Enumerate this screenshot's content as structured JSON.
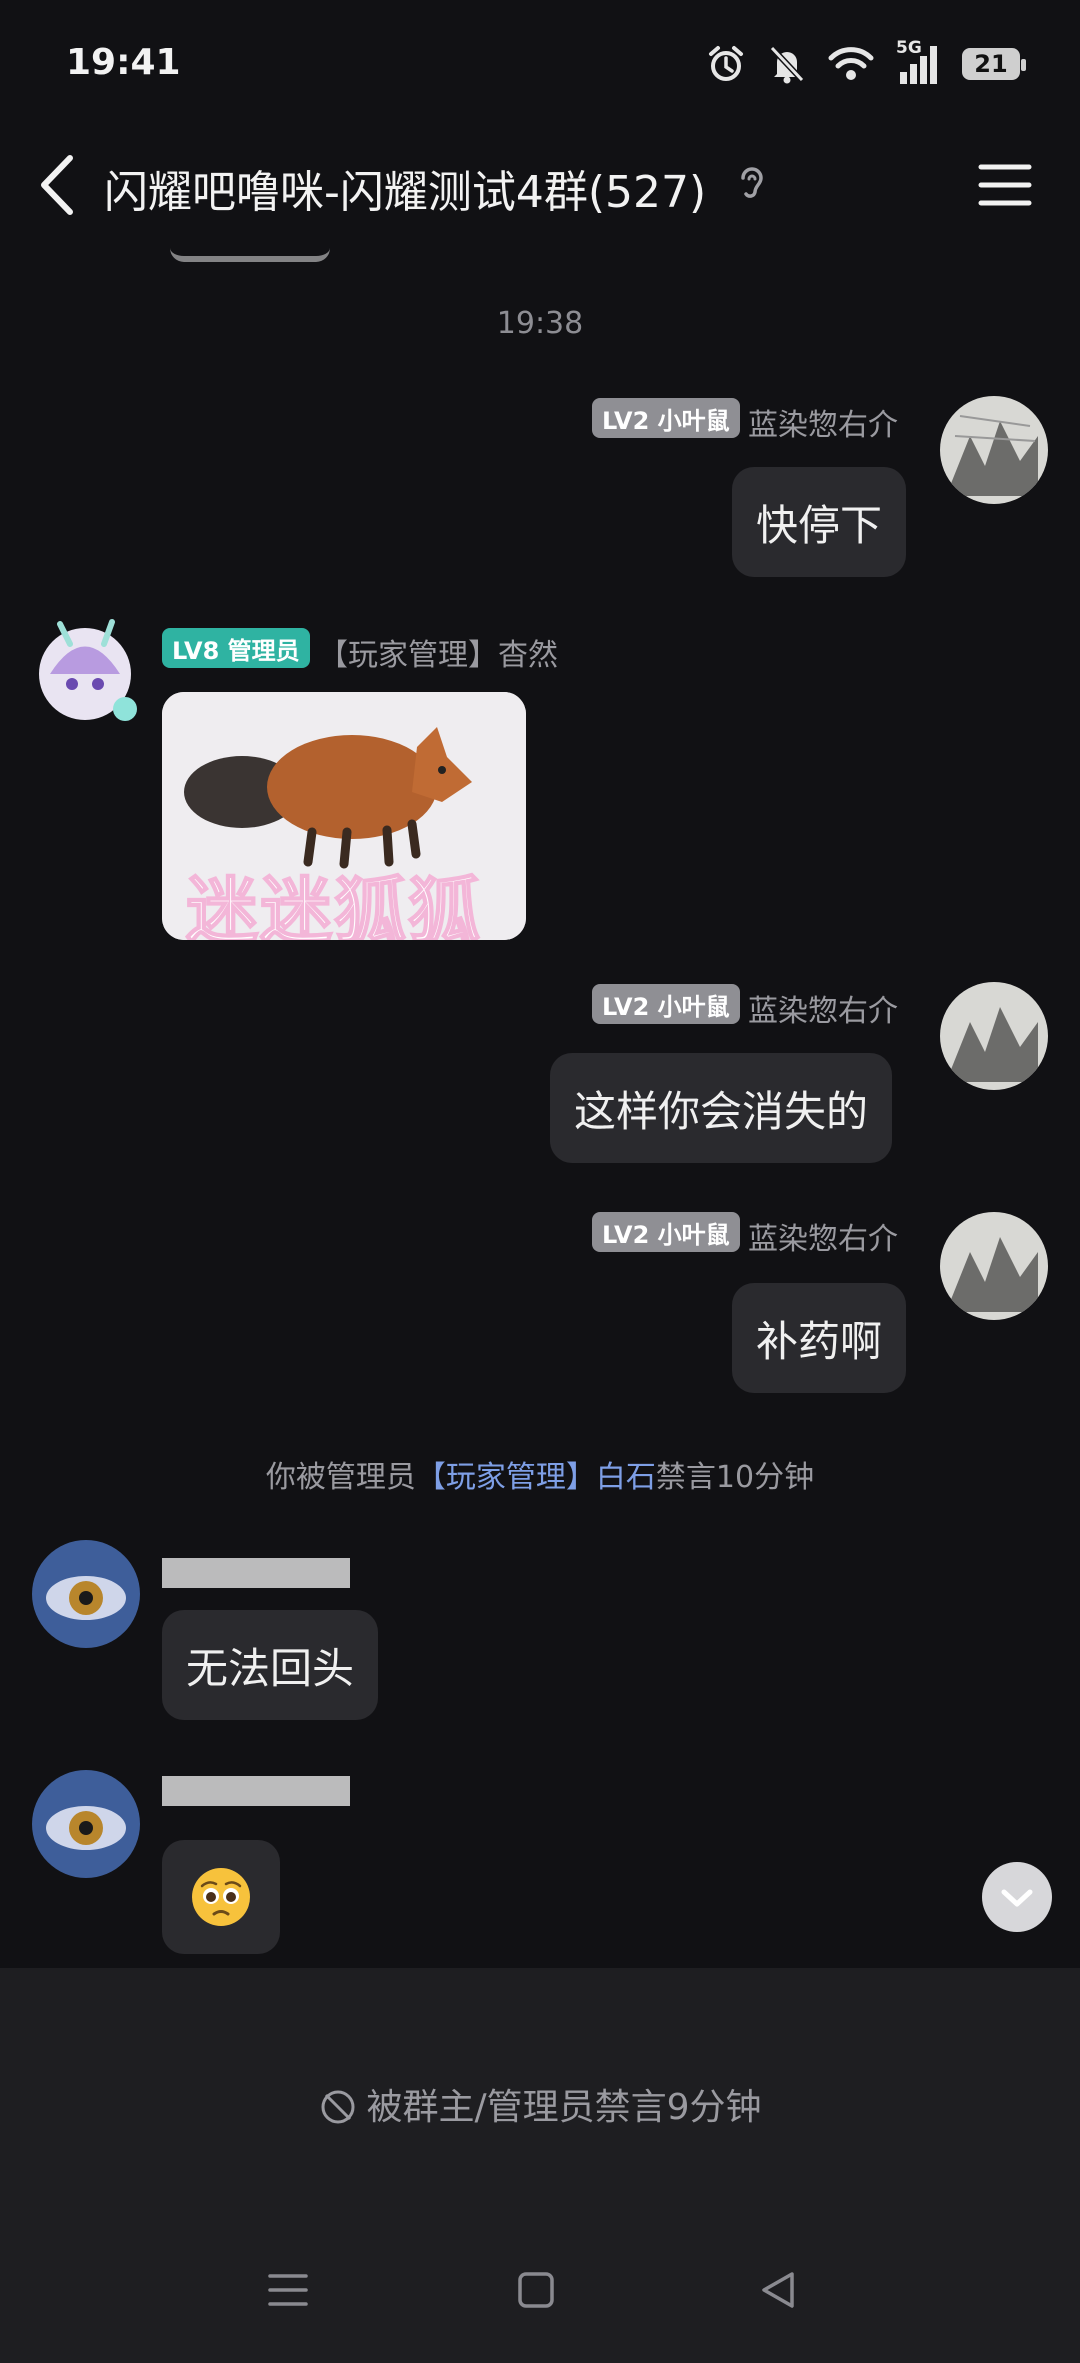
{
  "status_bar": {
    "time": "19:41",
    "network": "5G",
    "battery": "21"
  },
  "header": {
    "title": "闪耀吧噜咪-闪耀测试4群(527)"
  },
  "timestamp": "19:38",
  "messages": [
    {
      "badge": "LV2 小叶鼠",
      "sender": "蓝染惣右介",
      "text": "快停下"
    },
    {
      "badge": "LV8 管理员",
      "sender": "【玩家管理】杳然",
      "sticker_caption": "迷迷狐狐"
    },
    {
      "badge": "LV2 小叶鼠",
      "sender": "蓝染惣右介",
      "text": "这样你会消失的"
    },
    {
      "badge": "LV2 小叶鼠",
      "sender": "蓝染惣右介",
      "text": "补药啊"
    },
    {
      "text": "无法回头"
    },
    {
      "emoji": "🥺"
    }
  ],
  "system_notice": {
    "prefix": "你被管理员",
    "admin": "【玩家管理】白石",
    "suffix": "禁言10分钟"
  },
  "mute_notice": "被群主/管理员禁言9分钟",
  "colors": {
    "background": "#111114",
    "bubble": "#2a2a2e",
    "admin_badge": "#2fb3a2",
    "level_badge": "#8f8f94",
    "link": "#7e9fe6"
  },
  "icons": [
    "back-arrow-icon",
    "ear-icon",
    "menu-icon",
    "alarm-icon",
    "bell-off-icon",
    "wifi-icon",
    "signal-icon",
    "battery-icon",
    "scroll-down-icon",
    "mute-icon"
  ]
}
